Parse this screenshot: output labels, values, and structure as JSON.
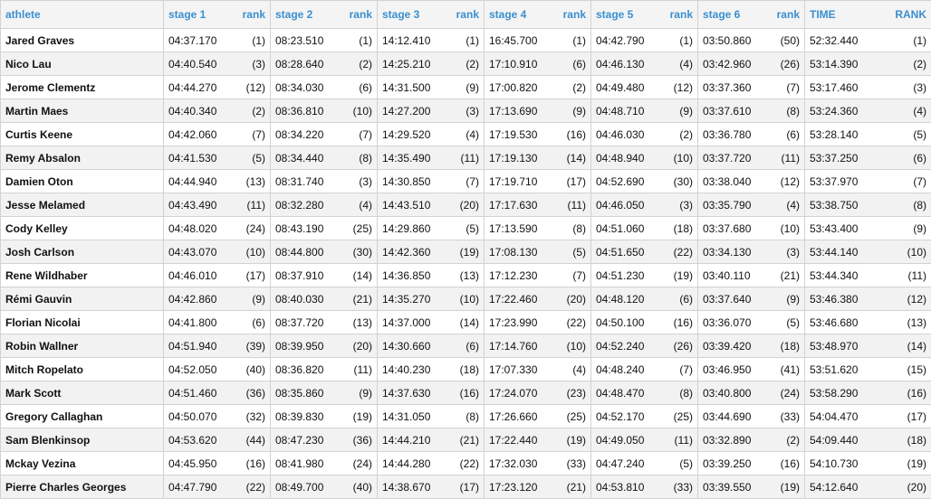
{
  "headers": [
    "athlete",
    "stage 1",
    "rank",
    "stage 2",
    "rank",
    "stage 3",
    "rank",
    "stage 4",
    "rank",
    "stage 5",
    "rank",
    "stage 6",
    "rank",
    "TIME",
    "RANK"
  ],
  "rows": [
    [
      "Jared Graves",
      "04:37.170",
      "(1)",
      "08:23.510",
      "(1)",
      "14:12.410",
      "(1)",
      "16:45.700",
      "(1)",
      "04:42.790",
      "(1)",
      "03:50.860",
      "(50)",
      "52:32.440",
      "(1)"
    ],
    [
      "Nico Lau",
      "04:40.540",
      "(3)",
      "08:28.640",
      "(2)",
      "14:25.210",
      "(2)",
      "17:10.910",
      "(6)",
      "04:46.130",
      "(4)",
      "03:42.960",
      "(26)",
      "53:14.390",
      "(2)"
    ],
    [
      "Jerome Clementz",
      "04:44.270",
      "(12)",
      "08:34.030",
      "(6)",
      "14:31.500",
      "(9)",
      "17:00.820",
      "(2)",
      "04:49.480",
      "(12)",
      "03:37.360",
      "(7)",
      "53:17.460",
      "(3)"
    ],
    [
      "Martin Maes",
      "04:40.340",
      "(2)",
      "08:36.810",
      "(10)",
      "14:27.200",
      "(3)",
      "17:13.690",
      "(9)",
      "04:48.710",
      "(9)",
      "03:37.610",
      "(8)",
      "53:24.360",
      "(4)"
    ],
    [
      "Curtis Keene",
      "04:42.060",
      "(7)",
      "08:34.220",
      "(7)",
      "14:29.520",
      "(4)",
      "17:19.530",
      "(16)",
      "04:46.030",
      "(2)",
      "03:36.780",
      "(6)",
      "53:28.140",
      "(5)"
    ],
    [
      "Remy Absalon",
      "04:41.530",
      "(5)",
      "08:34.440",
      "(8)",
      "14:35.490",
      "(11)",
      "17:19.130",
      "(14)",
      "04:48.940",
      "(10)",
      "03:37.720",
      "(11)",
      "53:37.250",
      "(6)"
    ],
    [
      "Damien Oton",
      "04:44.940",
      "(13)",
      "08:31.740",
      "(3)",
      "14:30.850",
      "(7)",
      "17:19.710",
      "(17)",
      "04:52.690",
      "(30)",
      "03:38.040",
      "(12)",
      "53:37.970",
      "(7)"
    ],
    [
      "Jesse Melamed",
      "04:43.490",
      "(11)",
      "08:32.280",
      "(4)",
      "14:43.510",
      "(20)",
      "17:17.630",
      "(11)",
      "04:46.050",
      "(3)",
      "03:35.790",
      "(4)",
      "53:38.750",
      "(8)"
    ],
    [
      "Cody Kelley",
      "04:48.020",
      "(24)",
      "08:43.190",
      "(25)",
      "14:29.860",
      "(5)",
      "17:13.590",
      "(8)",
      "04:51.060",
      "(18)",
      "03:37.680",
      "(10)",
      "53:43.400",
      "(9)"
    ],
    [
      "Josh Carlson",
      "04:43.070",
      "(10)",
      "08:44.800",
      "(30)",
      "14:42.360",
      "(19)",
      "17:08.130",
      "(5)",
      "04:51.650",
      "(22)",
      "03:34.130",
      "(3)",
      "53:44.140",
      "(10)"
    ],
    [
      "Rene Wildhaber",
      "04:46.010",
      "(17)",
      "08:37.910",
      "(14)",
      "14:36.850",
      "(13)",
      "17:12.230",
      "(7)",
      "04:51.230",
      "(19)",
      "03:40.110",
      "(21)",
      "53:44.340",
      "(11)"
    ],
    [
      "Rémi Gauvin",
      "04:42.860",
      "(9)",
      "08:40.030",
      "(21)",
      "14:35.270",
      "(10)",
      "17:22.460",
      "(20)",
      "04:48.120",
      "(6)",
      "03:37.640",
      "(9)",
      "53:46.380",
      "(12)"
    ],
    [
      "Florian Nicolai",
      "04:41.800",
      "(6)",
      "08:37.720",
      "(13)",
      "14:37.000",
      "(14)",
      "17:23.990",
      "(22)",
      "04:50.100",
      "(16)",
      "03:36.070",
      "(5)",
      "53:46.680",
      "(13)"
    ],
    [
      "Robin Wallner",
      "04:51.940",
      "(39)",
      "08:39.950",
      "(20)",
      "14:30.660",
      "(6)",
      "17:14.760",
      "(10)",
      "04:52.240",
      "(26)",
      "03:39.420",
      "(18)",
      "53:48.970",
      "(14)"
    ],
    [
      "Mitch Ropelato",
      "04:52.050",
      "(40)",
      "08:36.820",
      "(11)",
      "14:40.230",
      "(18)",
      "17:07.330",
      "(4)",
      "04:48.240",
      "(7)",
      "03:46.950",
      "(41)",
      "53:51.620",
      "(15)"
    ],
    [
      "Mark Scott",
      "04:51.460",
      "(36)",
      "08:35.860",
      "(9)",
      "14:37.630",
      "(16)",
      "17:24.070",
      "(23)",
      "04:48.470",
      "(8)",
      "03:40.800",
      "(24)",
      "53:58.290",
      "(16)"
    ],
    [
      "Gregory Callaghan",
      "04:50.070",
      "(32)",
      "08:39.830",
      "(19)",
      "14:31.050",
      "(8)",
      "17:26.660",
      "(25)",
      "04:52.170",
      "(25)",
      "03:44.690",
      "(33)",
      "54:04.470",
      "(17)"
    ],
    [
      "Sam Blenkinsop",
      "04:53.620",
      "(44)",
      "08:47.230",
      "(36)",
      "14:44.210",
      "(21)",
      "17:22.440",
      "(19)",
      "04:49.050",
      "(11)",
      "03:32.890",
      "(2)",
      "54:09.440",
      "(18)"
    ],
    [
      "Mckay Vezina",
      "04:45.950",
      "(16)",
      "08:41.980",
      "(24)",
      "14:44.280",
      "(22)",
      "17:32.030",
      "(33)",
      "04:47.240",
      "(5)",
      "03:39.250",
      "(16)",
      "54:10.730",
      "(19)"
    ],
    [
      "Pierre Charles Georges",
      "04:47.790",
      "(22)",
      "08:49.700",
      "(40)",
      "14:38.670",
      "(17)",
      "17:23.120",
      "(21)",
      "04:53.810",
      "(33)",
      "03:39.550",
      "(19)",
      "54:12.640",
      "(20)"
    ]
  ]
}
